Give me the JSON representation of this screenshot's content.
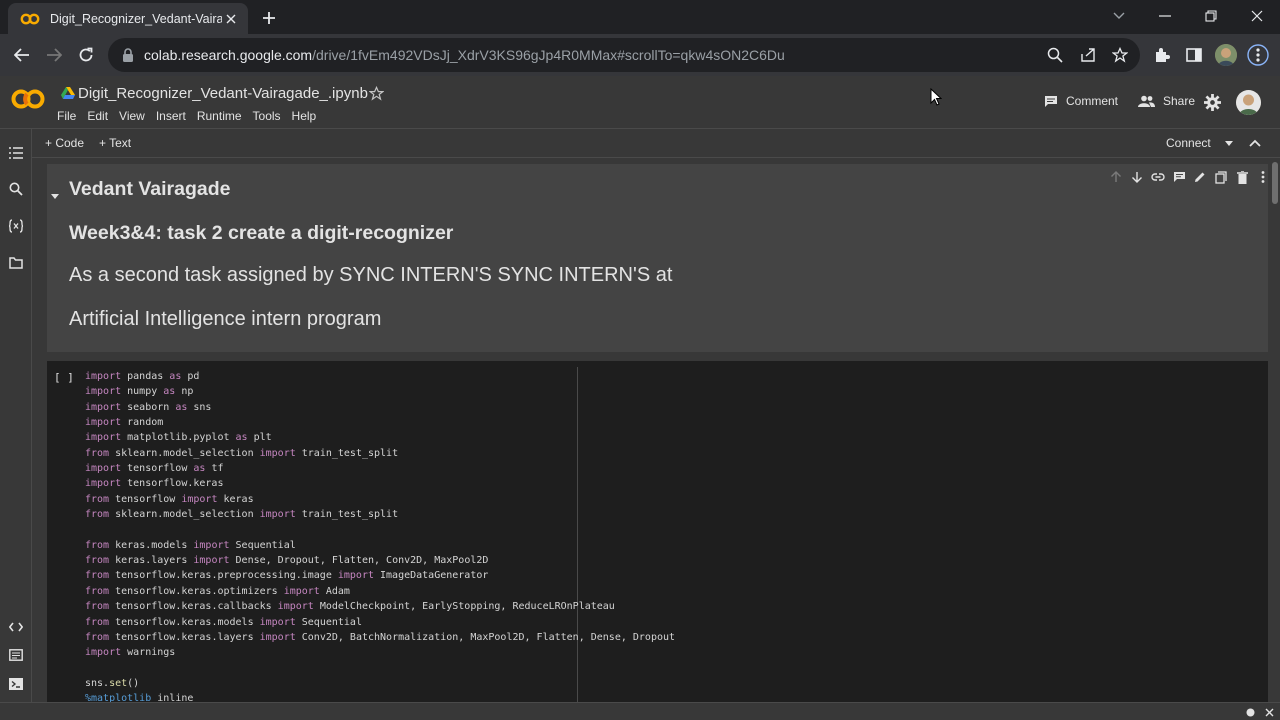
{
  "browser": {
    "tab_title": "Digit_Recognizer_Vedant-Vairagade_.ipynb - Colaboratory",
    "url_host": "colab.research.google.com",
    "url_path": "/drive/1fvEm492VDsJj_XdrV3KS96gJp4R0MMax#scrollTo=qkw4sON2C6Du"
  },
  "colab": {
    "notebook_title": "Digit_Recognizer_Vedant-Vairagade_.ipynb",
    "menu": [
      "File",
      "Edit",
      "View",
      "Insert",
      "Runtime",
      "Tools",
      "Help"
    ],
    "comment_label": "Comment",
    "share_label": "Share",
    "add_code_label": "+ Code",
    "add_text_label": "+ Text",
    "connect_label": "Connect"
  },
  "text_cell": {
    "heading1": "Vedant Vairagade",
    "heading2": "Week3&4: task 2 create a digit-recognizer",
    "para1": "As a second task assigned by SYNC INTERN'S SYNC INTERN'S at",
    "para2": "Artificial Intelligence intern program"
  },
  "code_cell": {
    "run_label": "[ ]",
    "lines": [
      [
        [
          "kw",
          "import"
        ],
        [
          "t",
          " pandas "
        ],
        [
          "kw",
          "as"
        ],
        [
          "t",
          " pd"
        ]
      ],
      [
        [
          "kw",
          "import"
        ],
        [
          "t",
          " numpy "
        ],
        [
          "kw",
          "as"
        ],
        [
          "t",
          " np"
        ]
      ],
      [
        [
          "kw",
          "import"
        ],
        [
          "t",
          " seaborn "
        ],
        [
          "kw",
          "as"
        ],
        [
          "t",
          " sns"
        ]
      ],
      [
        [
          "kw",
          "import"
        ],
        [
          "t",
          " random"
        ]
      ],
      [
        [
          "kw",
          "import"
        ],
        [
          "t",
          " matplotlib.pyplot "
        ],
        [
          "kw",
          "as"
        ],
        [
          "t",
          " plt"
        ]
      ],
      [
        [
          "kw",
          "from"
        ],
        [
          "t",
          " sklearn.model_selection "
        ],
        [
          "kw",
          "import"
        ],
        [
          "t",
          " train_test_split"
        ]
      ],
      [
        [
          "kw",
          "import"
        ],
        [
          "t",
          " tensorflow "
        ],
        [
          "kw",
          "as"
        ],
        [
          "t",
          " tf"
        ]
      ],
      [
        [
          "kw",
          "import"
        ],
        [
          "t",
          " tensorflow.keras"
        ]
      ],
      [
        [
          "kw",
          "from"
        ],
        [
          "t",
          " tensorflow "
        ],
        [
          "kw",
          "import"
        ],
        [
          "t",
          " keras"
        ]
      ],
      [
        [
          "kw",
          "from"
        ],
        [
          "t",
          " sklearn.model_selection "
        ],
        [
          "kw",
          "import"
        ],
        [
          "t",
          " train_test_split"
        ]
      ],
      [],
      [
        [
          "kw",
          "from"
        ],
        [
          "t",
          " keras.models "
        ],
        [
          "kw",
          "import"
        ],
        [
          "t",
          " Sequential"
        ]
      ],
      [
        [
          "kw",
          "from"
        ],
        [
          "t",
          " keras.layers "
        ],
        [
          "kw",
          "import"
        ],
        [
          "t",
          " Dense, Dropout, Flatten, Conv2D, MaxPool2D"
        ]
      ],
      [
        [
          "kw",
          "from"
        ],
        [
          "t",
          " tensorflow.keras.preprocessing.image "
        ],
        [
          "kw",
          "import"
        ],
        [
          "t",
          " ImageDataGenerator"
        ]
      ],
      [
        [
          "kw",
          "from"
        ],
        [
          "t",
          " tensorflow.keras.optimizers "
        ],
        [
          "kw",
          "import"
        ],
        [
          "t",
          " Adam"
        ]
      ],
      [
        [
          "kw",
          "from"
        ],
        [
          "t",
          " tensorflow.keras.callbacks "
        ],
        [
          "kw",
          "import"
        ],
        [
          "t",
          " ModelCheckpoint, EarlyStopping, ReduceLROnPlateau"
        ]
      ],
      [
        [
          "kw",
          "from"
        ],
        [
          "t",
          " tensorflow.keras.models "
        ],
        [
          "kw",
          "import"
        ],
        [
          "t",
          " Sequential"
        ]
      ],
      [
        [
          "kw",
          "from"
        ],
        [
          "t",
          " tensorflow.keras.layers "
        ],
        [
          "kw",
          "import"
        ],
        [
          "t",
          " Conv2D, BatchNormalization, MaxPool2D, Flatten, Dense, Dropout"
        ]
      ],
      [
        [
          "kw",
          "import"
        ],
        [
          "t",
          " warnings"
        ]
      ],
      [],
      [
        [
          "t",
          "sns."
        ],
        [
          "fn",
          "set"
        ],
        [
          "t",
          "()"
        ]
      ],
      [
        [
          "mg",
          "%matplotlib"
        ],
        [
          "t",
          " inline"
        ]
      ]
    ]
  },
  "colors": {
    "colab_orange": "#f9ab00",
    "keyword": "#c586c0",
    "magic": "#569cd6",
    "function": "#dcdcaa"
  }
}
